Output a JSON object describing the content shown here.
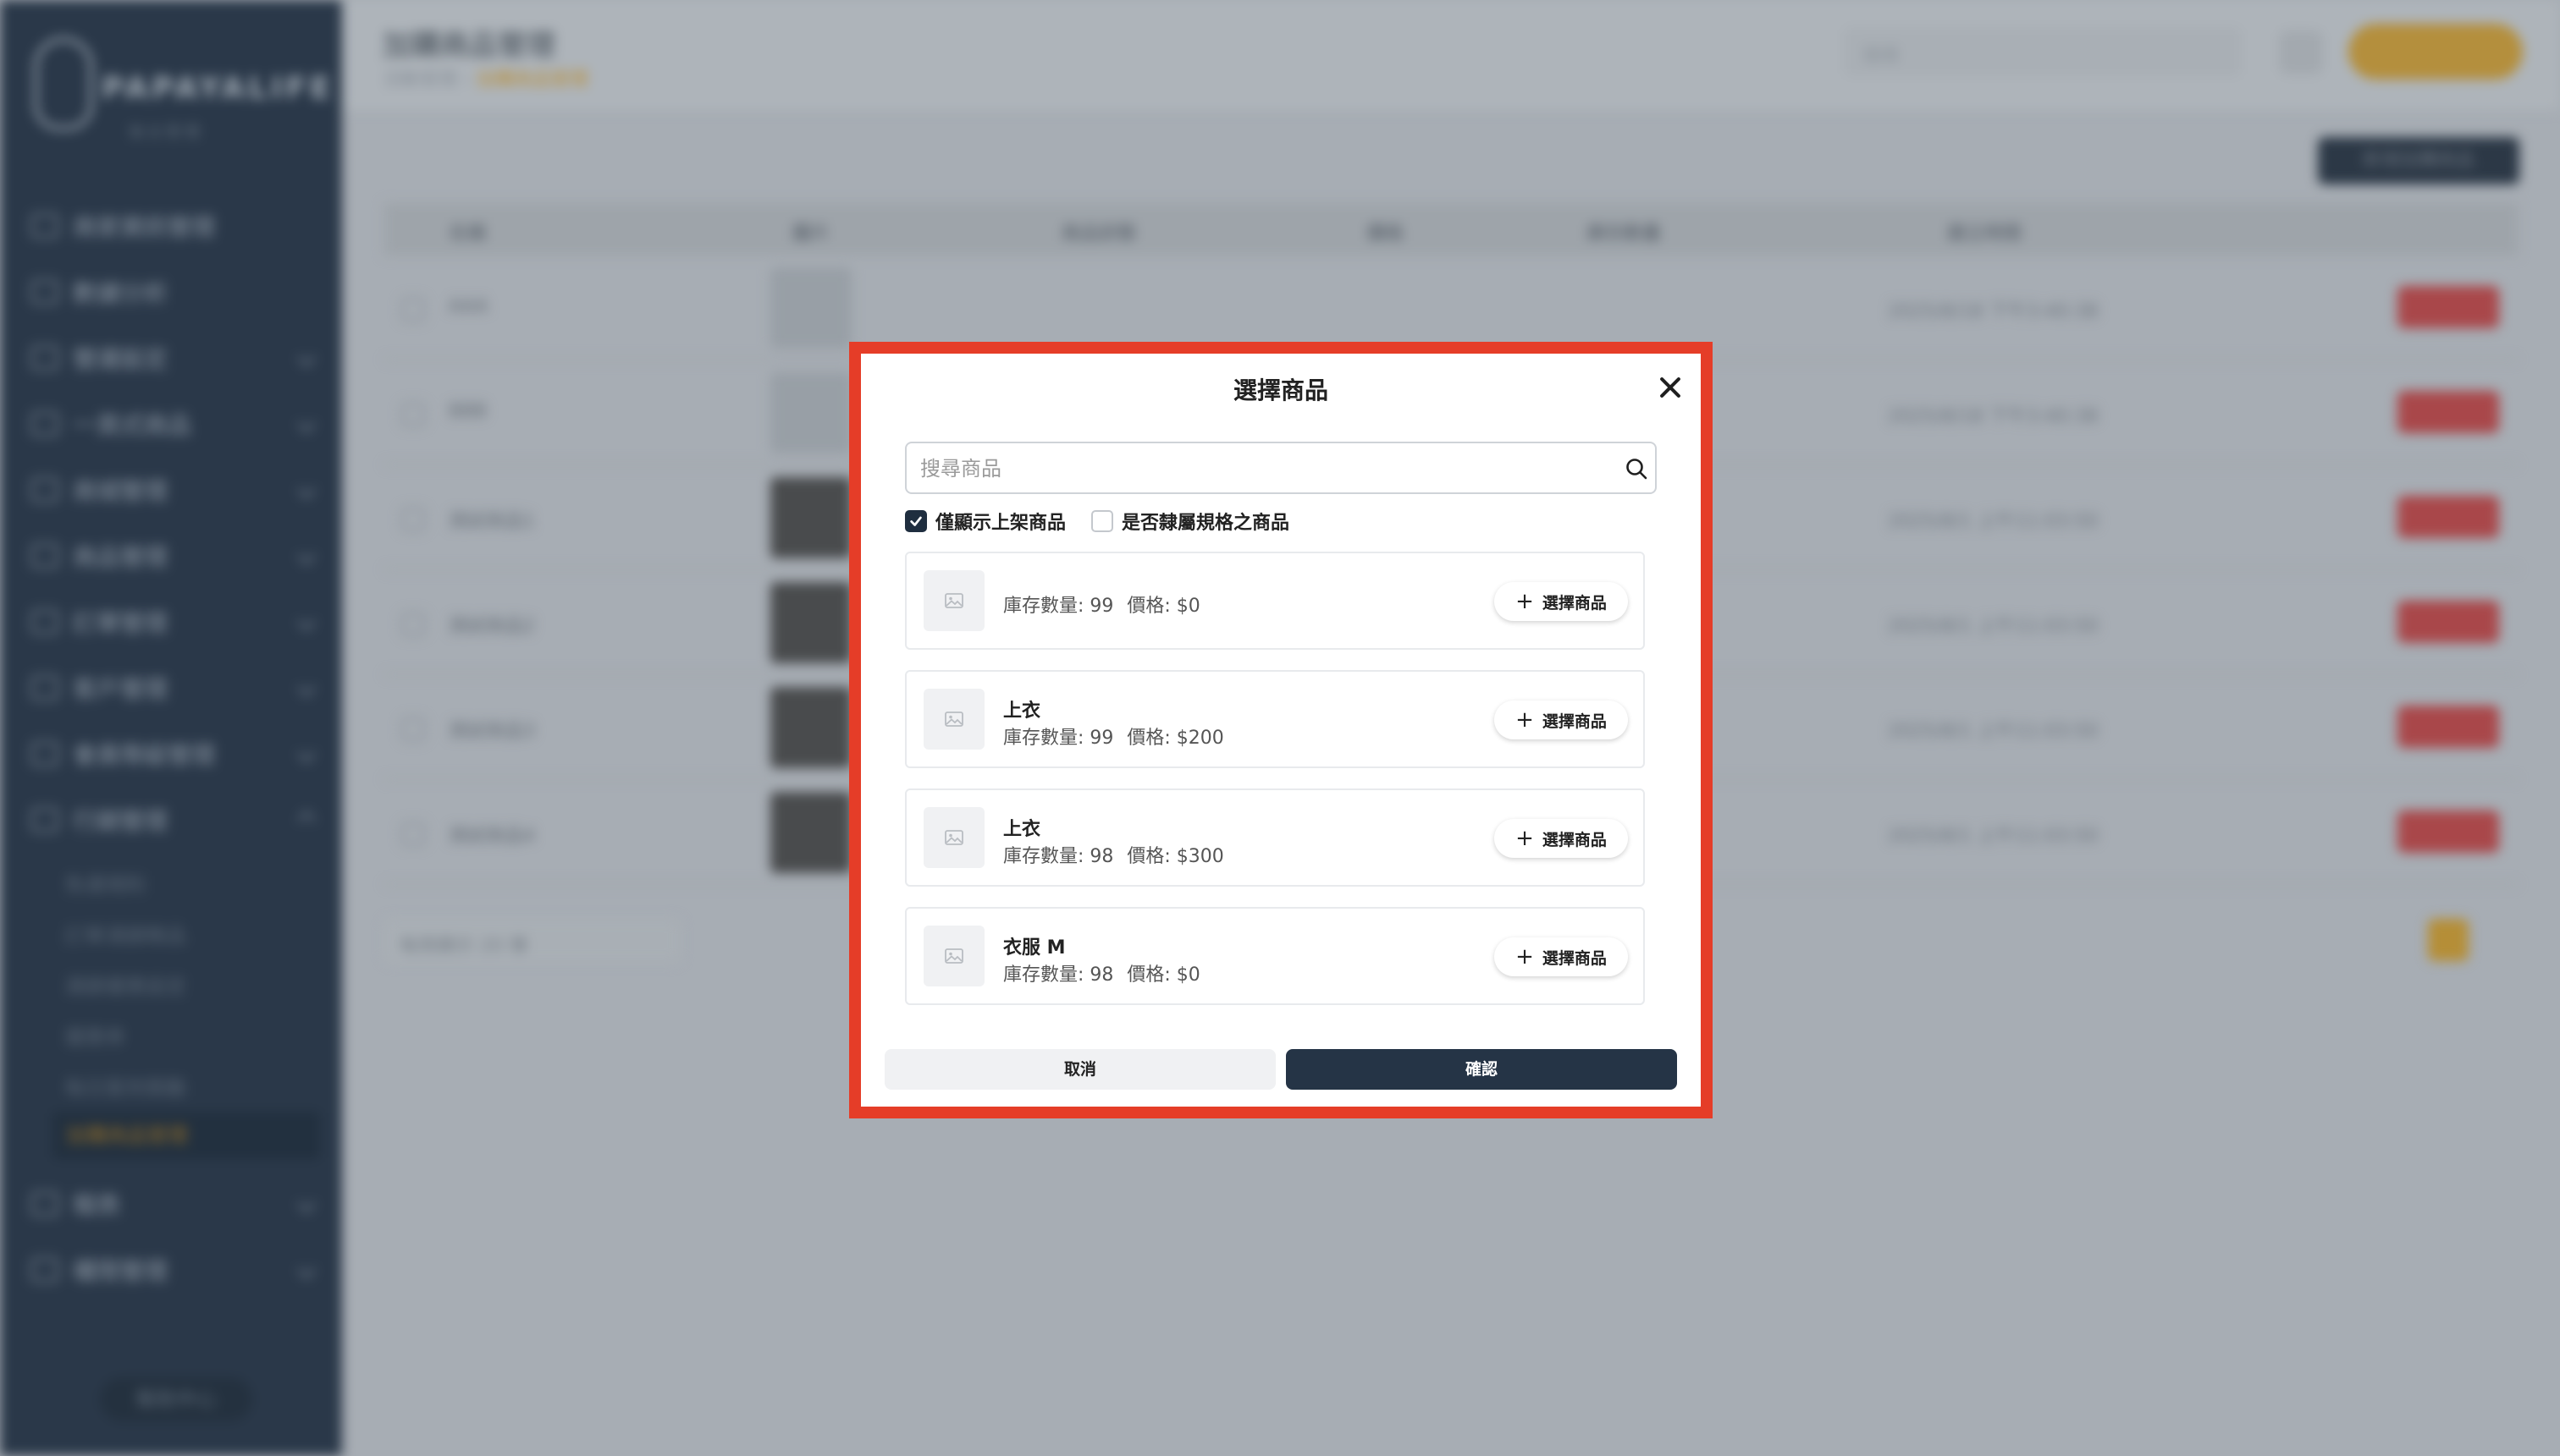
{
  "app": {
    "brand": "PAPAYALIFE",
    "brand_sub": "後台管理",
    "page_title": "加購商品管理",
    "breadcrumb": [
      "活動管理",
      "加購商品管理"
    ],
    "top_search_placeholder": "搜尋",
    "user_label": "PAPAYALIFE",
    "add_button": "新增加購商品",
    "sidebar": [
      {
        "label": "商家資訊管理"
      },
      {
        "label": "數據分析"
      },
      {
        "label": "營運設定"
      },
      {
        "label": "一頁式商品"
      },
      {
        "label": "商城管理"
      },
      {
        "label": "商品管理"
      },
      {
        "label": "訂單管理"
      },
      {
        "label": "客戶管理"
      },
      {
        "label": "會員等級管理"
      },
      {
        "label": "行銷管理"
      },
      {
        "label": "報表"
      },
      {
        "label": "權限管理"
      }
    ],
    "submenu": [
      "免運規則",
      "訂單滿額贈品",
      "滿額優惠設定",
      "優惠券",
      "每日簽到獎勵",
      "加購商品管理"
    ],
    "help": "幫助中心",
    "table_headers": [
      "名稱",
      "圖片",
      "商品狀態",
      "價格",
      "庫存數量",
      "建立時間"
    ],
    "rows": [
      {
        "name": "AAA",
        "date": "2025/8/18 下午3:40:38"
      },
      {
        "name": "BBB",
        "date": "2025/8/18 下午3:40:38"
      },
      {
        "name": "測試商品1",
        "date": "2025/8/1 上午11:03:50"
      },
      {
        "name": "測試商品2",
        "date": "2025/8/1 上午11:03:50"
      },
      {
        "name": "測試商品3",
        "date": "2025/8/1 上午11:03:50"
      },
      {
        "name": "測試商品4",
        "date": "2025/8/1 上午11:03:50"
      }
    ],
    "page_size": "每頁顯示 20 筆",
    "current_page": "1"
  },
  "modal": {
    "title": "選擇商品",
    "search_placeholder": "搜尋商品",
    "filters": [
      {
        "label": "僅顯示上架商品",
        "checked": true
      },
      {
        "label": "是否隸屬規格之商品",
        "checked": false
      }
    ],
    "items": [
      {
        "title": "",
        "stock": "庫存數量: 99",
        "price": "價格: $0",
        "button": "選擇商品"
      },
      {
        "title": "上衣",
        "stock": "庫存數量: 99",
        "price": "價格: $200",
        "button": "選擇商品"
      },
      {
        "title": "上衣",
        "stock": "庫存數量: 98",
        "price": "價格: $300",
        "button": "選擇商品"
      },
      {
        "title": "衣服 M",
        "stock": "庫存數量: 98",
        "price": "價格: $0",
        "button": "選擇商品"
      }
    ],
    "cancel": "取消",
    "confirm": "確認"
  },
  "colors": {
    "highlight": "#e53d28",
    "primary_dark": "#253446",
    "sidebar_bg": "#2a3849",
    "accent_gold": "#b58e37",
    "danger": "#a9474a"
  }
}
